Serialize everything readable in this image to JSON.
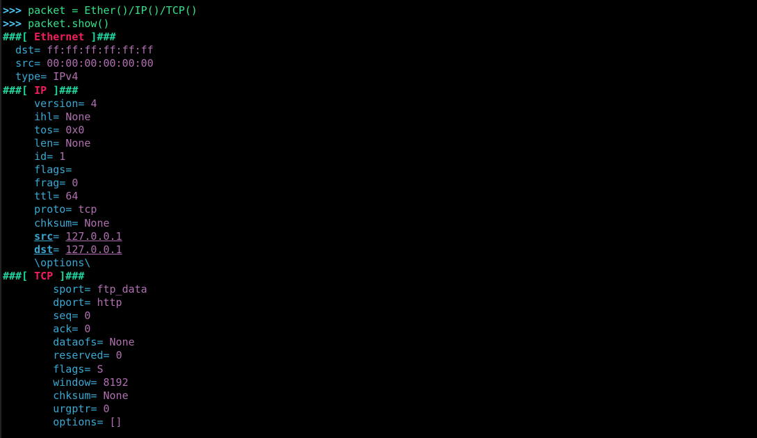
{
  "terminal": {
    "title": "Scapy interactive shell",
    "background_color": "#000000",
    "colors": {
      "prompt": "#4ec9f5",
      "code": "#34e28a",
      "hash_marker": "#1fd6a0",
      "layer_name": "#f01f5c",
      "field_name": "#39a9d4",
      "field_value": "#b06fb0"
    },
    "prompt_symbol": ">>>",
    "commands": [
      {
        "prompt": ">>> ",
        "text": "packet = Ether()/IP()/TCP()"
      },
      {
        "prompt": ">>> ",
        "text": "packet.show()"
      }
    ],
    "layers": [
      {
        "header_open": "###[ ",
        "name": "Ethernet",
        "header_close": " ]###",
        "indent": "  ",
        "fields": [
          {
            "name": "dst",
            "sep": "= ",
            "value": "ff:ff:ff:ff:ff:ff",
            "underline": false
          },
          {
            "name": "src",
            "sep": "= ",
            "value": "00:00:00:00:00:00",
            "underline": false
          },
          {
            "name": "type",
            "sep": "= ",
            "value": "IPv4",
            "underline": false
          }
        ]
      },
      {
        "header_open": "###[ ",
        "name": "IP",
        "header_close": " ]###",
        "indent": "     ",
        "fields": [
          {
            "name": "version",
            "sep": "= ",
            "value": "4",
            "underline": false
          },
          {
            "name": "ihl",
            "sep": "= ",
            "value": "None",
            "underline": false
          },
          {
            "name": "tos",
            "sep": "= ",
            "value": "0x0",
            "underline": false
          },
          {
            "name": "len",
            "sep": "= ",
            "value": "None",
            "underline": false
          },
          {
            "name": "id",
            "sep": "= ",
            "value": "1",
            "underline": false
          },
          {
            "name": "flags",
            "sep": "= ",
            "value": "",
            "underline": false
          },
          {
            "name": "frag",
            "sep": "= ",
            "value": "0",
            "underline": false
          },
          {
            "name": "ttl",
            "sep": "= ",
            "value": "64",
            "underline": false
          },
          {
            "name": "proto",
            "sep": "= ",
            "value": "tcp",
            "underline": false
          },
          {
            "name": "chksum",
            "sep": "= ",
            "value": "None",
            "underline": false
          },
          {
            "name": "src",
            "sep": "= ",
            "value": "127.0.0.1",
            "underline": true
          },
          {
            "name": "dst",
            "sep": "= ",
            "value": "127.0.0.1",
            "underline": true
          }
        ],
        "trailer": "\\options\\"
      },
      {
        "header_open": "###[ ",
        "name": "TCP",
        "header_close": " ]###",
        "indent": "        ",
        "fields": [
          {
            "name": "sport",
            "sep": "= ",
            "value": "ftp_data",
            "underline": false
          },
          {
            "name": "dport",
            "sep": "= ",
            "value": "http",
            "underline": false
          },
          {
            "name": "seq",
            "sep": "= ",
            "value": "0",
            "underline": false
          },
          {
            "name": "ack",
            "sep": "= ",
            "value": "0",
            "underline": false
          },
          {
            "name": "dataofs",
            "sep": "= ",
            "value": "None",
            "underline": false
          },
          {
            "name": "reserved",
            "sep": "= ",
            "value": "0",
            "underline": false
          },
          {
            "name": "flags",
            "sep": "= ",
            "value": "S",
            "underline": false
          },
          {
            "name": "window",
            "sep": "= ",
            "value": "8192",
            "underline": false
          },
          {
            "name": "chksum",
            "sep": "= ",
            "value": "None",
            "underline": false
          },
          {
            "name": "urgptr",
            "sep": "= ",
            "value": "0",
            "underline": false
          },
          {
            "name": "options",
            "sep": "= ",
            "value": "[]",
            "underline": false
          }
        ]
      }
    ]
  }
}
